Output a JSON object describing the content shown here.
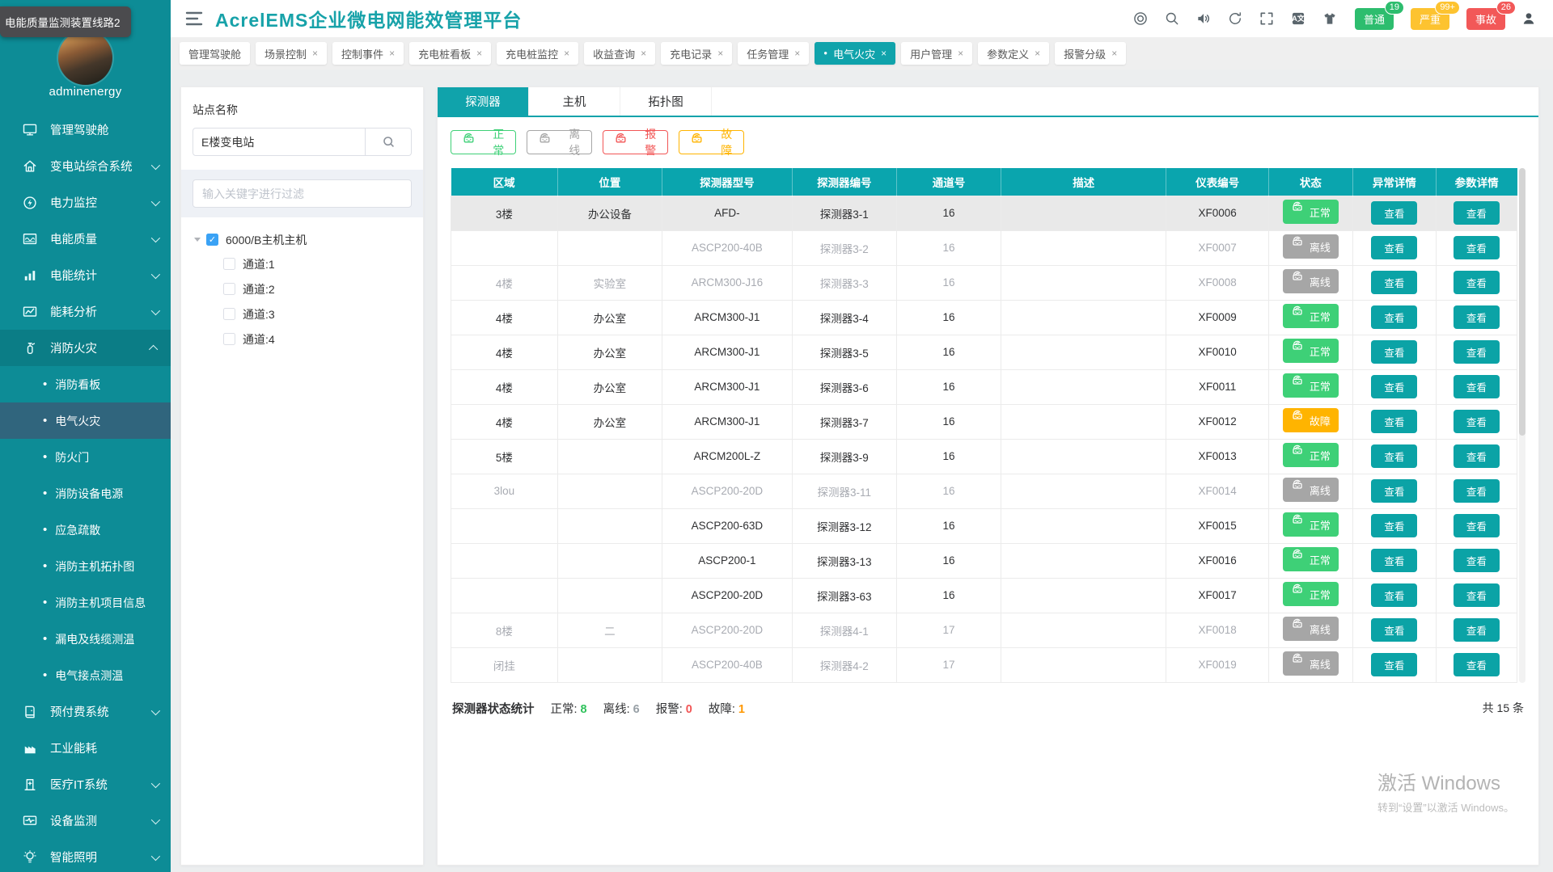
{
  "tooltip": {
    "text": "电能质量监测装置线路2"
  },
  "header": {
    "title": "AcrelEMS企业微电网能效管理平台",
    "icons": [
      "compass-icon",
      "search-icon",
      "volume-icon",
      "refresh-icon",
      "fullscreen-icon",
      "translate-icon",
      "theme-icon"
    ],
    "badges": [
      {
        "label": "普通",
        "count": "19",
        "type": "normal"
      },
      {
        "label": "严重",
        "count": "99+",
        "type": "warn"
      },
      {
        "label": "事故",
        "count": "26",
        "type": "danger"
      }
    ]
  },
  "tabstrip": {
    "tabs": [
      {
        "label": "管理驾驶舱",
        "closable": false,
        "active": false
      },
      {
        "label": "场景控制",
        "closable": true,
        "active": false
      },
      {
        "label": "控制事件",
        "closable": true,
        "active": false
      },
      {
        "label": "充电桩看板",
        "closable": true,
        "active": false
      },
      {
        "label": "充电桩监控",
        "closable": true,
        "active": false
      },
      {
        "label": "收益查询",
        "closable": true,
        "active": false
      },
      {
        "label": "充电记录",
        "closable": true,
        "active": false
      },
      {
        "label": "任务管理",
        "closable": true,
        "active": false
      },
      {
        "label": "电气火灾",
        "closable": true,
        "active": true
      },
      {
        "label": "用户管理",
        "closable": true,
        "active": false
      },
      {
        "label": "参数定义",
        "closable": true,
        "active": false
      },
      {
        "label": "报警分级",
        "closable": true,
        "active": false
      }
    ]
  },
  "sidebar": {
    "username": "adminenergy",
    "items": [
      {
        "icon": "dashboard-icon",
        "label": "管理驾驶舱",
        "chevron": false
      },
      {
        "icon": "home-icon",
        "label": "变电站综合系统",
        "chevron": true
      },
      {
        "icon": "power-icon",
        "label": "电力监控",
        "chevron": true
      },
      {
        "icon": "quality-icon",
        "label": "电能质量",
        "chevron": true
      },
      {
        "icon": "stats-icon",
        "label": "电能统计",
        "chevron": true
      },
      {
        "icon": "analysis-icon",
        "label": "能耗分析",
        "chevron": true
      },
      {
        "icon": "fire-icon",
        "label": "消防火灾",
        "chevron": true,
        "expanded": true,
        "children": [
          "消防看板",
          "电气火灾",
          "防火门",
          "消防设备电源",
          "应急疏散",
          "消防主机拓扑图",
          "消防主机项目信息",
          "漏电及线缆测温",
          "电气接点测温"
        ],
        "active_child": "电气火灾"
      },
      {
        "icon": "prepaid-icon",
        "label": "预付费系统",
        "chevron": true
      },
      {
        "icon": "industry-icon",
        "label": "工业能耗",
        "chevron": false
      },
      {
        "icon": "medical-icon",
        "label": "医疗IT系统",
        "chevron": true
      },
      {
        "icon": "device-icon",
        "label": "设备监测",
        "chevron": true
      },
      {
        "icon": "light-icon",
        "label": "智能照明",
        "chevron": true
      }
    ]
  },
  "station_panel": {
    "title": "站点名称",
    "search_value": "E楼变电站",
    "filter_placeholder": "输入关键字进行过滤",
    "tree": {
      "root": "6000/B主机主机",
      "root_checked": true,
      "children": [
        "通道:1",
        "通道:2",
        "通道:3",
        "通道:4"
      ]
    }
  },
  "main": {
    "tabs": [
      "探测器",
      "主机",
      "拓扑图"
    ],
    "active_tab": "探测器",
    "filters": [
      {
        "label": "正常",
        "type": "normal"
      },
      {
        "label": "离线",
        "type": "offline"
      },
      {
        "label": "报警",
        "type": "alarm"
      },
      {
        "label": "故障",
        "type": "fault"
      }
    ],
    "view_label": "查看",
    "table": {
      "columns": [
        "区域",
        "位置",
        "探测器型号",
        "探测器编号",
        "通道号",
        "描述",
        "仪表编号",
        "状态",
        "异常详情",
        "参数详情"
      ],
      "rows": [
        {
          "area": "3楼",
          "position": "办公设备",
          "model": "AFD-",
          "code": "探测器3-1",
          "channel": "16",
          "desc": "",
          "meter": "XF0006",
          "status": "正常",
          "status_type": "normal",
          "highlight": true
        },
        {
          "area": "",
          "position": "",
          "model": "ASCP200-40B",
          "code": "探测器3-2",
          "channel": "16",
          "desc": "",
          "meter": "XF0007",
          "status": "离线",
          "status_type": "offline"
        },
        {
          "area": "4楼",
          "position": "实验室",
          "model": "ARCM300-J16",
          "code": "探测器3-3",
          "channel": "16",
          "desc": "",
          "meter": "XF0008",
          "status": "离线",
          "status_type": "offline"
        },
        {
          "area": "4楼",
          "position": "办公室",
          "model": "ARCM300-J1",
          "code": "探测器3-4",
          "channel": "16",
          "desc": "",
          "meter": "XF0009",
          "status": "正常",
          "status_type": "normal"
        },
        {
          "area": "4楼",
          "position": "办公室",
          "model": "ARCM300-J1",
          "code": "探测器3-5",
          "channel": "16",
          "desc": "",
          "meter": "XF0010",
          "status": "正常",
          "status_type": "normal"
        },
        {
          "area": "4楼",
          "position": "办公室",
          "model": "ARCM300-J1",
          "code": "探测器3-6",
          "channel": "16",
          "desc": "",
          "meter": "XF0011",
          "status": "正常",
          "status_type": "normal"
        },
        {
          "area": "4楼",
          "position": "办公室",
          "model": "ARCM300-J1",
          "code": "探测器3-7",
          "channel": "16",
          "desc": "",
          "meter": "XF0012",
          "status": "故障",
          "status_type": "fault"
        },
        {
          "area": "5楼",
          "position": "",
          "model": "ARCM200L-Z",
          "code": "探测器3-9",
          "channel": "16",
          "desc": "",
          "meter": "XF0013",
          "status": "正常",
          "status_type": "normal"
        },
        {
          "area": "3lou",
          "position": "",
          "model": "ASCP200-20D",
          "code": "探测器3-11",
          "channel": "16",
          "desc": "",
          "meter": "XF0014",
          "status": "离线",
          "status_type": "offline"
        },
        {
          "area": "",
          "position": "",
          "model": "ASCP200-63D",
          "code": "探测器3-12",
          "channel": "16",
          "desc": "",
          "meter": "XF0015",
          "status": "正常",
          "status_type": "normal"
        },
        {
          "area": "",
          "position": "",
          "model": "ASCP200-1",
          "code": "探测器3-13",
          "channel": "16",
          "desc": "",
          "meter": "XF0016",
          "status": "正常",
          "status_type": "normal"
        },
        {
          "area": "",
          "position": "",
          "model": "ASCP200-20D",
          "code": "探测器3-63",
          "channel": "16",
          "desc": "",
          "meter": "XF0017",
          "status": "正常",
          "status_type": "normal"
        },
        {
          "area": "8楼",
          "position": "二",
          "model": "ASCP200-20D",
          "code": "探测器4-1",
          "channel": "17",
          "desc": "",
          "meter": "XF0018",
          "status": "离线",
          "status_type": "offline"
        },
        {
          "area": "闭挂",
          "position": "",
          "model": "ASCP200-40B",
          "code": "探测器4-2",
          "channel": "17",
          "desc": "",
          "meter": "XF0019",
          "status": "离线",
          "status_type": "offline"
        }
      ]
    },
    "stats": {
      "title": "探测器状态统计",
      "items": [
        {
          "label": "正常:",
          "value": "8",
          "type": "normal"
        },
        {
          "label": "离线:",
          "value": "6",
          "type": "offline"
        },
        {
          "label": "报警:",
          "value": "0",
          "type": "alarm"
        },
        {
          "label": "故障:",
          "value": "1",
          "type": "fault"
        }
      ],
      "total": "共 15 条"
    },
    "watermark": {
      "line1": "激活 Windows",
      "line2": "转到“设置”以激活 Windows。"
    }
  },
  "colors": {
    "teal": "#10a3ab",
    "sidebar": "#0d8c96",
    "normal": "#3ed077",
    "offline": "#a6a6a6",
    "alarm": "#f25656",
    "fault": "#ffb400",
    "stat_normal": "#2fc25b",
    "stat_offline": "#98a0a6",
    "stat_alarm": "#f25656",
    "stat_fault": "#ff9800",
    "badge_normal": "#2dbd6e",
    "badge_warn": "#fdc330",
    "badge_danger": "#f25858"
  }
}
